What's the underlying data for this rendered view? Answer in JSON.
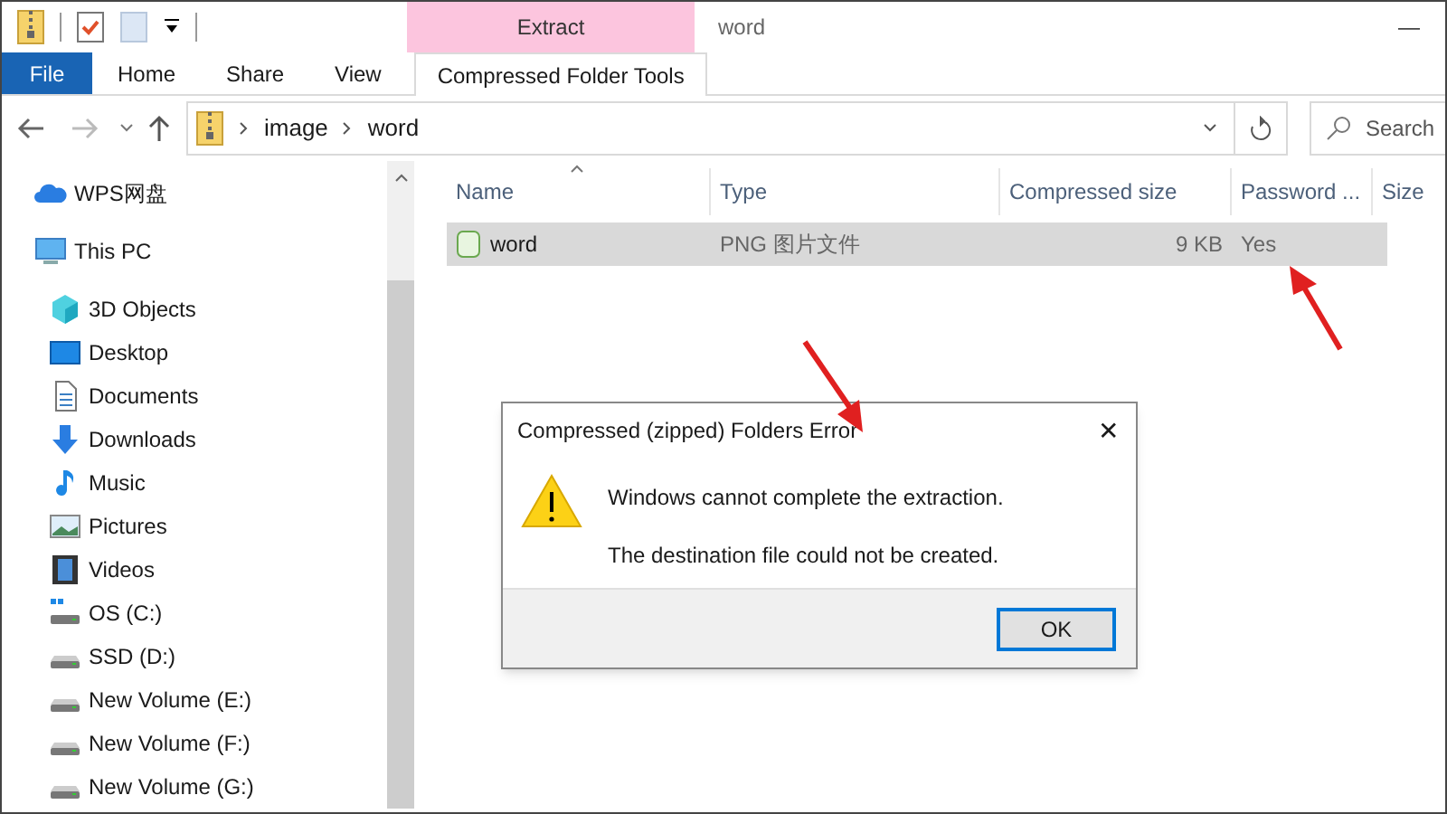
{
  "window": {
    "title": "word",
    "context_tab": "Extract",
    "minimize": "—"
  },
  "ribbon_tabs": [
    {
      "label": "File",
      "kind": "file",
      "selected": false
    },
    {
      "label": "Home",
      "kind": "tab",
      "selected": false
    },
    {
      "label": "Share",
      "kind": "tab",
      "selected": false
    },
    {
      "label": "View",
      "kind": "tab",
      "selected": false
    },
    {
      "label": "Compressed Folder Tools",
      "kind": "tab",
      "selected": true
    }
  ],
  "address": {
    "path": [
      "image",
      "word"
    ]
  },
  "search": {
    "placeholder": "Search"
  },
  "sidebar": {
    "items": [
      {
        "label": "WPS网盘",
        "kind": "cloud"
      },
      {
        "label": "This PC",
        "kind": "pc",
        "children": [
          {
            "label": "3D Objects",
            "kind": "cube"
          },
          {
            "label": "Desktop",
            "kind": "desktop"
          },
          {
            "label": "Documents",
            "kind": "doc"
          },
          {
            "label": "Downloads",
            "kind": "download"
          },
          {
            "label": "Music",
            "kind": "music"
          },
          {
            "label": "Pictures",
            "kind": "pictures"
          },
          {
            "label": "Videos",
            "kind": "video"
          },
          {
            "label": "OS (C:)",
            "kind": "osdrive"
          },
          {
            "label": "SSD (D:)",
            "kind": "drive"
          },
          {
            "label": "New Volume (E:)",
            "kind": "drive"
          },
          {
            "label": "New Volume (F:)",
            "kind": "drive"
          },
          {
            "label": "New Volume (G:)",
            "kind": "drive"
          }
        ]
      }
    ]
  },
  "table": {
    "columns": [
      "Name",
      "Type",
      "Compressed size",
      "Password ...",
      "Size"
    ],
    "rows": [
      {
        "name": "word",
        "type": "PNG 图片文件",
        "compressed_size": "9 KB",
        "password": "Yes",
        "selected": true
      }
    ]
  },
  "dialog": {
    "title": "Compressed (zipped) Folders Error",
    "close": "✕",
    "messages": [
      "Windows cannot complete the extraction.",
      "The destination file could not be created."
    ],
    "buttons": [
      "OK"
    ]
  }
}
